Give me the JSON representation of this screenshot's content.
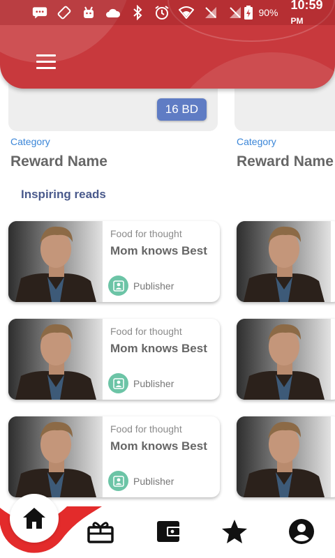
{
  "status_bar": {
    "battery_percent": "90%",
    "time": "10:59",
    "am_pm": "PM",
    "icons": [
      "message-icon",
      "rotate-icon",
      "android-icon",
      "cloud-icon",
      "bluetooth-icon",
      "alarm-icon",
      "wifi-icon",
      "no-signal-icon",
      "no-signal-icon",
      "battery-charging-icon"
    ]
  },
  "header": {
    "menu_icon": "hamburger-menu-icon",
    "accent": "#c8393d"
  },
  "rewards": [
    {
      "price": "16 BD",
      "category": "Category",
      "name": "Reward Name"
    },
    {
      "category": "Category",
      "name": "Reward Name"
    }
  ],
  "section": {
    "title": "Inspiring reads"
  },
  "reads": [
    {
      "category": "Food for thought",
      "title": "Mom knows Best",
      "publisher": "Publisher"
    },
    {
      "category": "Food for thought",
      "title": "Mom knows Best",
      "publisher": "Publisher"
    },
    {
      "category": "Food for thought",
      "title": "Mom knows Best",
      "publisher": "Publisher"
    }
  ],
  "bottom_nav": {
    "items": [
      "home-icon",
      "rewards-gift-icon",
      "wallet-icon",
      "star-icon",
      "profile-icon"
    ],
    "active": "home",
    "accent": "#e32b2b"
  }
}
